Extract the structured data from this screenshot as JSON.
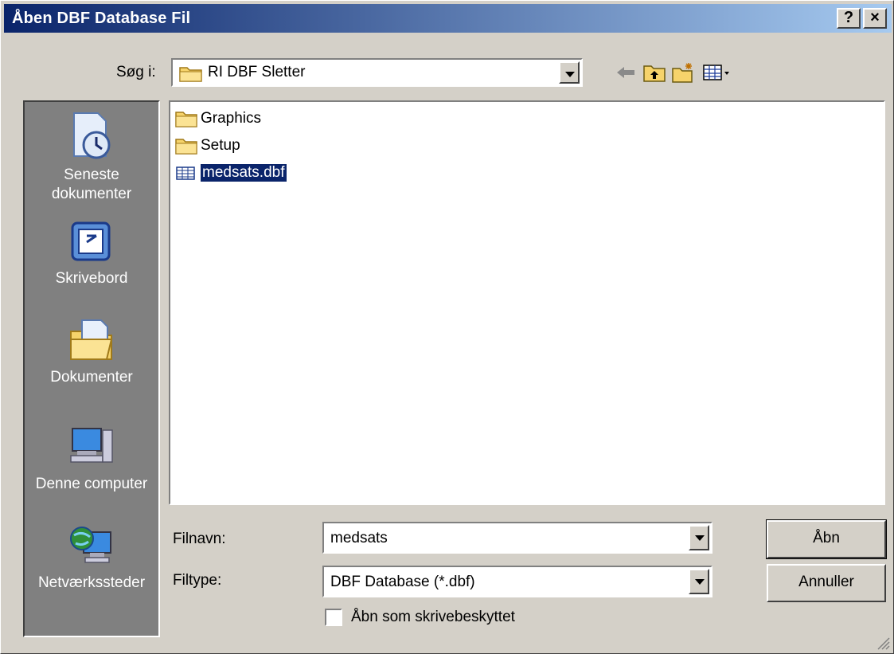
{
  "window": {
    "title": "Åben DBF Database Fil",
    "help_button": "?",
    "close_button": "×"
  },
  "lookin": {
    "label": "Søg i:",
    "value": "RI DBF Sletter"
  },
  "toolbar": {
    "back_icon": "back-arrow-icon",
    "up_icon": "up-folder-icon",
    "new_folder_icon": "new-folder-icon",
    "views_icon": "views-menu-icon"
  },
  "places": [
    {
      "label": "Seneste dokumenter",
      "icon": "recent-documents-icon"
    },
    {
      "label": "Skrivebord",
      "icon": "desktop-icon"
    },
    {
      "label": "Dokumenter",
      "icon": "my-documents-icon"
    },
    {
      "label": "Denne computer",
      "icon": "my-computer-icon"
    },
    {
      "label": "Netværkssteder",
      "icon": "network-places-icon"
    }
  ],
  "files": [
    {
      "name": "Graphics",
      "type": "folder"
    },
    {
      "name": "Setup",
      "type": "folder"
    },
    {
      "name": "medsats.dbf",
      "type": "dbf",
      "selected": true
    }
  ],
  "filename": {
    "label": "Filnavn:",
    "value": "medsats"
  },
  "filetype": {
    "label": "Filtype:",
    "value": "DBF Database (*.dbf)"
  },
  "readonly_label": "Åbn som skrivebeskyttet",
  "buttons": {
    "open": "Åbn",
    "cancel": "Annuller"
  },
  "colors": {
    "title_gradient_start": "#0a246a",
    "title_gradient_end": "#a6caf0",
    "dialog_face": "#d4d0c8",
    "places_bar": "#808080",
    "selection": "#0a246a"
  }
}
